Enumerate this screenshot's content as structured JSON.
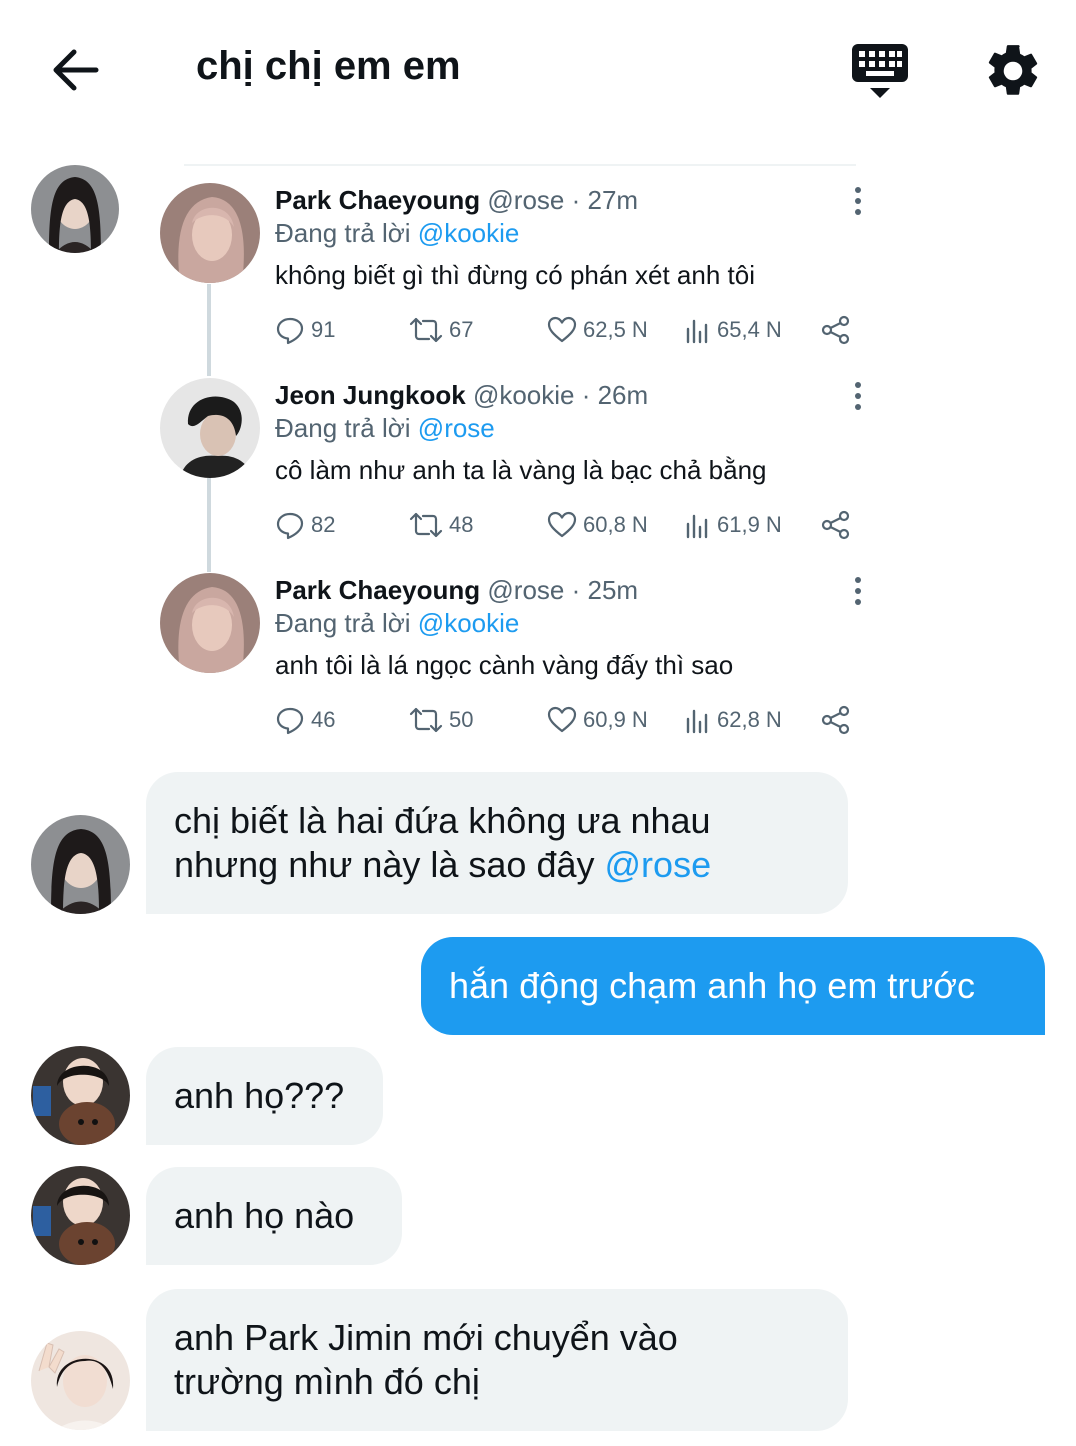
{
  "header": {
    "title": "chị chị em em",
    "back_icon": "arrow-left-icon",
    "keyboard_icon": "keyboard-icon",
    "settings_icon": "gear-icon"
  },
  "colors": {
    "accent": "#1d9bf0",
    "text": "#0f1419",
    "muted": "#536471",
    "bubble_in": "#eff3f4"
  },
  "thread": [
    {
      "name": "Park Chaeyoung",
      "handle_time": "@rose · 27m",
      "reply_prefix": "Đang trả lời",
      "reply_to": "@kookie",
      "text": "không biết gì thì đừng có phán xét anh tôi",
      "replies": "91",
      "retweets": "67",
      "likes": "62,5 N",
      "views": "65,4 N"
    },
    {
      "name": "Jeon Jungkook",
      "handle_time": "@kookie · 26m",
      "reply_prefix": "Đang trả lời",
      "reply_to": "@rose",
      "text": "cô làm như anh ta là vàng là bạc chả bằng",
      "replies": "82",
      "retweets": "48",
      "likes": "60,8 N",
      "views": "61,9 N"
    },
    {
      "name": "Park Chaeyoung",
      "handle_time": "@rose · 25m",
      "reply_prefix": "Đang trả lời",
      "reply_to": "@kookie",
      "text": "anh tôi là lá ngọc cành vàng đấy thì sao",
      "replies": "46",
      "retweets": "50",
      "likes": "60,9 N",
      "views": "62,8 N"
    }
  ],
  "messages": [
    {
      "direction": "in",
      "line1": "chị biết là hai đứa không ưa nhau",
      "line2": "nhưng như này là sao đây",
      "mention": "@rose"
    },
    {
      "direction": "out",
      "text": "hắn động chạm anh họ em trước"
    },
    {
      "direction": "in",
      "text": "anh họ???"
    },
    {
      "direction": "in",
      "text": "anh họ nào"
    },
    {
      "direction": "in",
      "line1": "anh Park Jimin mới chuyển vào",
      "line2": "trường mình đó chị"
    }
  ]
}
